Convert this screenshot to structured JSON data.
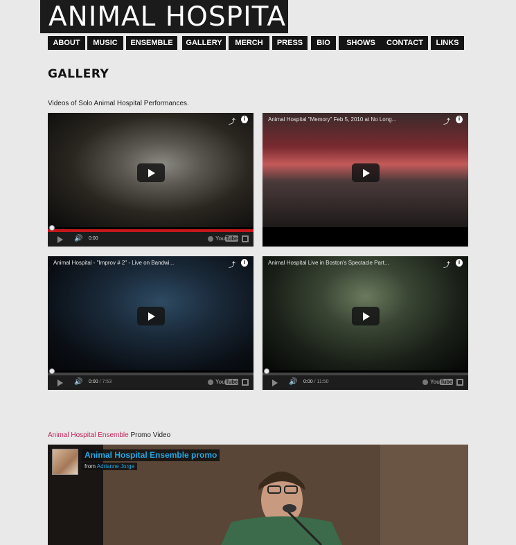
{
  "site": {
    "title": "ANIMAL HOSPITAL"
  },
  "nav": {
    "items": [
      {
        "label": "ABOUT"
      },
      {
        "label": "MUSIC"
      },
      {
        "label": "ENSEMBLE"
      },
      {
        "label": "GALLERY"
      },
      {
        "label": "MERCH"
      },
      {
        "label": "PRESS"
      },
      {
        "label": "BIO"
      },
      {
        "label": "SHOWS"
      },
      {
        "label": "CONTACT"
      },
      {
        "label": "LINKS"
      }
    ]
  },
  "page": {
    "title": "GALLERY",
    "intro": "Videos of Solo Animal Hospital Performances."
  },
  "videos": [
    {
      "title": "",
      "time": "0:00",
      "duration": "",
      "played": "red"
    },
    {
      "title": "Animal Hospital \"Memory\" Feb 5, 2010 at No Long...",
      "time": "",
      "duration": "",
      "played": "none"
    },
    {
      "title": "Animal Hospital - \"Improv # 2\" - Live on Bandwi...",
      "time": "0:00",
      "duration": " / 7:53",
      "played": "none"
    },
    {
      "title": "Animal Hospital Live in Boston's Spectacle Part...",
      "time": "0:00",
      "duration": " / 11:50",
      "played": "none"
    }
  ],
  "player": {
    "logo_text": "You",
    "logo_box": "Tube"
  },
  "promo": {
    "label_link": "Animal Hospital Ensemble",
    "label_rest": " Promo Video",
    "video_title": "Animal Hospital Ensemble promo",
    "from_prefix": "from ",
    "from_user": "Adrianne Jorge"
  },
  "colors": {
    "accent_pink": "#c4235a",
    "vimeo_blue": "#24a7e2",
    "nav_bg": "#141414",
    "page_bg": "#e9e9e9"
  },
  "icons": [
    "share-icon",
    "info-icon",
    "play-icon",
    "volume-icon",
    "clock-icon",
    "fullscreen-icon"
  ]
}
